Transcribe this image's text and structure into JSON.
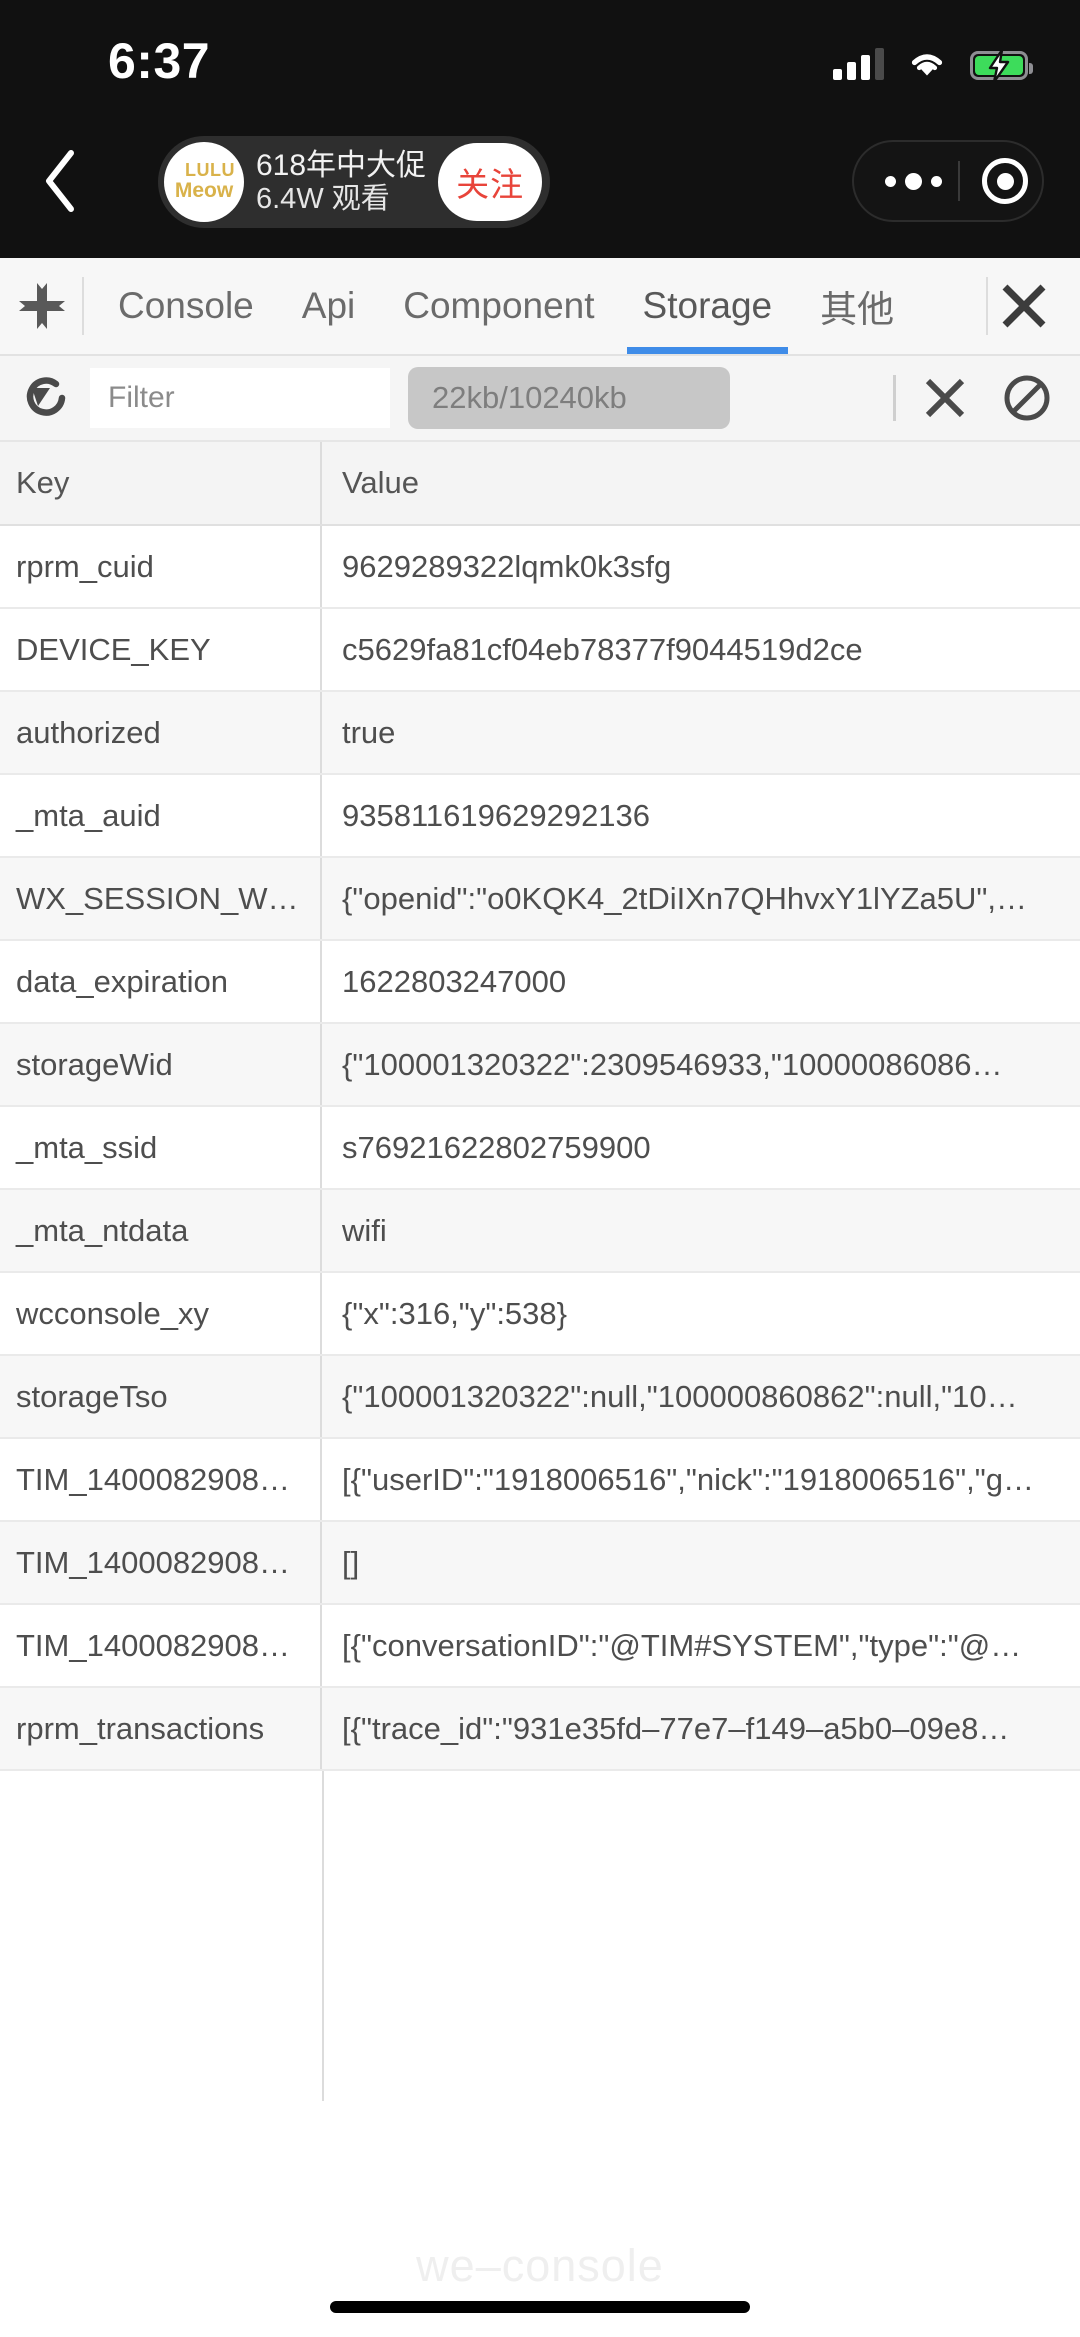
{
  "status_bar": {
    "time": "6:37",
    "signal_icon": "signal-bars-icon",
    "wifi_icon": "wifi-icon",
    "battery_icon": "battery-charging-icon"
  },
  "live_banner": {
    "back_icon": "back-chevron-icon",
    "avatar_line1": "LULU",
    "avatar_line2": "Meow",
    "title": "618年中大促",
    "viewers": "6.4W 观看",
    "follow_label": "关注",
    "follow_color": "#e8443a",
    "capsule": {
      "menu_icon": "more-dots-icon",
      "target_icon": "target-circle-icon"
    }
  },
  "devtools": {
    "move_icon": "move-handle-icon",
    "close_icon": "close-icon",
    "active_tab": "Storage",
    "accent_color": "#3f8ce8",
    "tabs": [
      {
        "label": "Console"
      },
      {
        "label": "Api"
      },
      {
        "label": "Component"
      },
      {
        "label": "Storage"
      },
      {
        "label": "其他"
      }
    ],
    "toolbar": {
      "refresh_icon": "refresh-icon",
      "filter_value": "",
      "filter_placeholder": "Filter",
      "size_badge": "22kb/10240kb",
      "clear_icon": "close-icon",
      "ban_icon": "clear-all-icon"
    },
    "table": {
      "columns": [
        "Key",
        "Value"
      ],
      "rows": [
        {
          "key": "rprm_cuid",
          "value": "9629289322lqmk0k3sfg"
        },
        {
          "key": "DEVICE_KEY",
          "value": "c5629fa81cf04eb78377f9044519d2ce"
        },
        {
          "key": "authorized",
          "value": "true"
        },
        {
          "key": "_mta_auid",
          "value": "935811619629292136"
        },
        {
          "key": "WX_SESSION_W…",
          "value": "{\"openid\":\"o0KQK4_2tDiIXn7QHhvxY1lYZa5U\",…"
        },
        {
          "key": "data_expiration",
          "value": "1622803247000"
        },
        {
          "key": "storageWid",
          "value": "{\"100001320322\":2309546933,\"10000086086…"
        },
        {
          "key": "_mta_ssid",
          "value": "s76921622802759900"
        },
        {
          "key": "_mta_ntdata",
          "value": "wifi"
        },
        {
          "key": "wcconsole_xy",
          "value": "{\"x\":316,\"y\":538}"
        },
        {
          "key": "storageTso",
          "value": "{\"100001320322\":null,\"100000860862\":null,\"10…"
        },
        {
          "key": "TIM_1400082908…",
          "value": "[{\"userID\":\"1918006516\",\"nick\":\"1918006516\",\"g…"
        },
        {
          "key": "TIM_1400082908…",
          "value": "[]"
        },
        {
          "key": "TIM_1400082908…",
          "value": "[{\"conversationID\":\"@TIM#SYSTEM\",\"type\":\"@…"
        },
        {
          "key": "rprm_transactions",
          "value": "[{\"trace_id\":\"931e35fd–77e7–f149–a5b0–09e8…"
        }
      ]
    }
  },
  "footer": {
    "watermark": "we–console"
  }
}
